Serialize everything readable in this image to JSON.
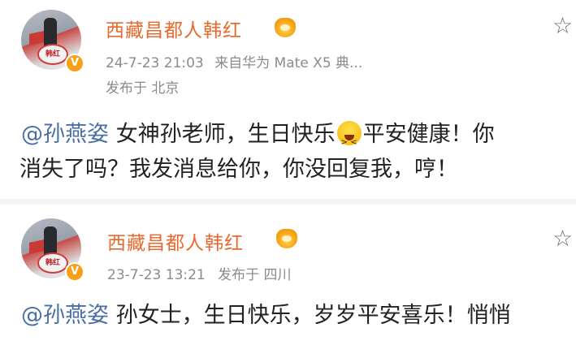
{
  "posts": [
    {
      "username": "西藏昌都人韩红",
      "avatar_stamp": "韩红",
      "timestamp": "24-7-23 21:03",
      "source": "来自华为 Mate X5 典...",
      "location": "发布于 北京",
      "mention": "@孙燕姿",
      "text_before_emoji": " 女神孙老师，生日快乐",
      "text_after_emoji": "平安健康！你",
      "text_line2": "消失了吗？我发消息给你，你没回复我，哼！"
    },
    {
      "username": "西藏昌都人韩红",
      "avatar_stamp": "韩红",
      "timestamp": "23-7-23 13:21",
      "location": "发布于 四川",
      "mention": "@孙燕姿",
      "text": " 孙女士，生日快乐，岁岁平安喜乐！悄悄"
    }
  ],
  "icons": {
    "verified_badge": "verified-v-icon",
    "member_crown": "crown-icon",
    "favorite": "star-icon",
    "emoji": "grinning-squint-emoji"
  },
  "colors": {
    "username": "#e9682d",
    "mention": "#4a6fa5",
    "meta": "#8b8b8b",
    "badge": "#f7a11a"
  }
}
